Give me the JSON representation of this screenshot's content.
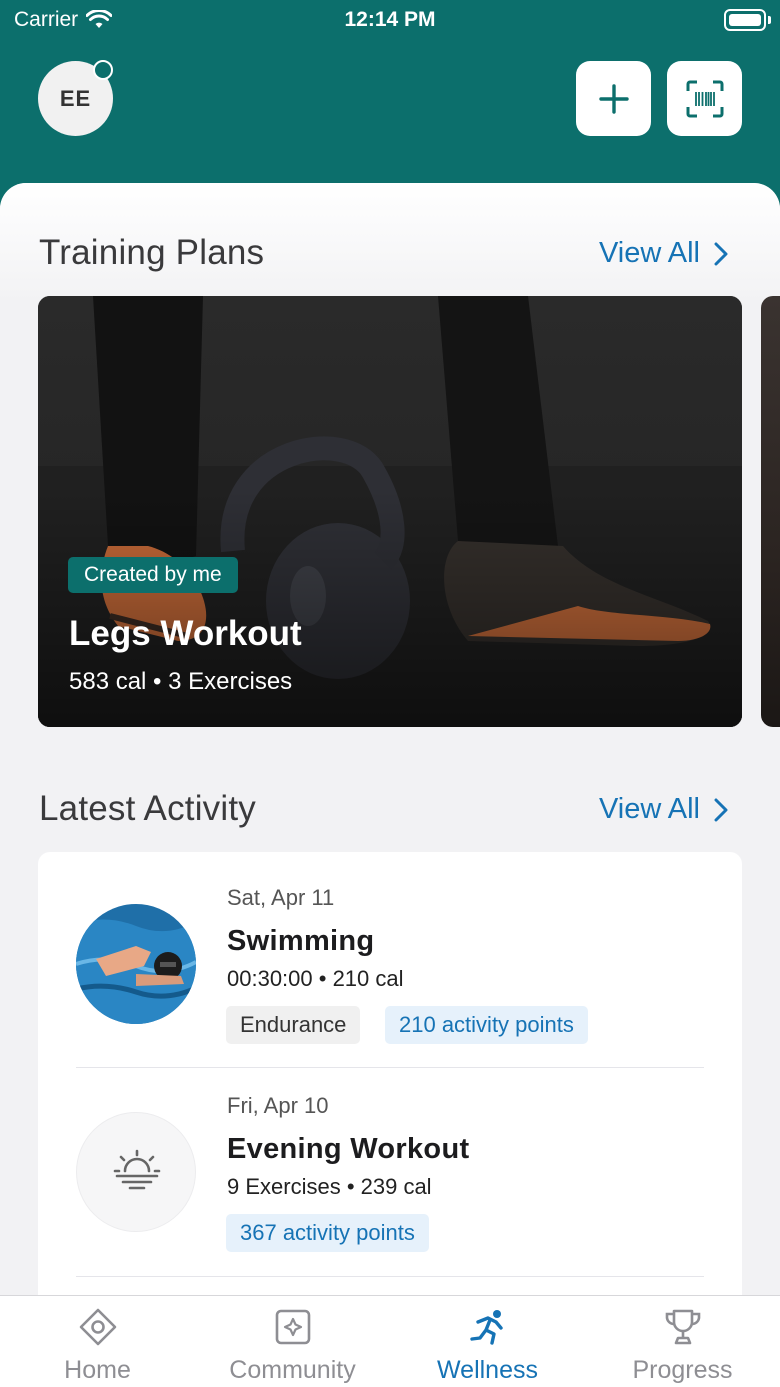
{
  "status_bar": {
    "carrier": "Carrier",
    "time": "12:14 PM"
  },
  "header": {
    "avatar_initials": "EE",
    "add_icon": "plus-icon",
    "scan_icon": "barcode-scan-icon",
    "background_color": "#0c6f6c"
  },
  "training_plans": {
    "title": "Training Plans",
    "view_all": "View All",
    "cards": [
      {
        "badge": "Created by me",
        "name": "Legs Workout",
        "meta": "583 cal • 3 Exercises"
      }
    ]
  },
  "latest_activity": {
    "title": "Latest Activity",
    "view_all": "View All",
    "items": [
      {
        "date": "Sat, Apr 11",
        "name": "Swimming",
        "meta": "00:30:00 • 210 cal",
        "tags": [
          "Endurance",
          "210 activity points"
        ],
        "icon": "swimmer-photo"
      },
      {
        "date": "Fri, Apr 10",
        "name": "Evening Workout",
        "meta": "9 Exercises • 239 cal",
        "tags": [
          "367 activity points"
        ],
        "icon": "sunset-icon"
      }
    ]
  },
  "tabbar": {
    "tabs": [
      {
        "label": "Home",
        "icon": "home-diamond-icon"
      },
      {
        "label": "Community",
        "icon": "community-icon"
      },
      {
        "label": "Wellness",
        "icon": "runner-icon",
        "active": true
      },
      {
        "label": "Progress",
        "icon": "trophy-icon"
      }
    ],
    "accent_color": "#1673b5"
  }
}
